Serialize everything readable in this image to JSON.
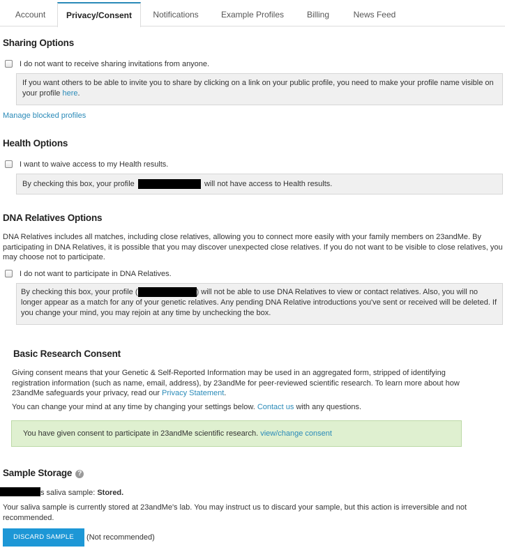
{
  "tabs": [
    "Account",
    "Privacy/Consent",
    "Notifications",
    "Example Profiles",
    "Billing",
    "News Feed"
  ],
  "sharing": {
    "title": "Sharing Options",
    "checkbox_label": "I do not want to receive sharing invitations from anyone.",
    "note_before": "If you want others to be able to invite you to share by clicking on a link on your public profile, you need to make your profile name visible on your profile ",
    "note_link": "here",
    "note_after": ".",
    "manage_link": "Manage blocked profiles"
  },
  "health": {
    "title": "Health Options",
    "checkbox_label": "I want to waive access to my Health results.",
    "note_before": "By checking this box, your profile",
    "note_after": "will not have access to Health results."
  },
  "dna": {
    "title": "DNA Relatives Options",
    "intro": "DNA Relatives includes all matches, including close relatives, allowing you to connect more easily with your family members on 23andMe. By participating in DNA Relatives, it is possible that you may discover unexpected close relatives. If you do not want to be visible to close relatives, you may choose not to participate.",
    "checkbox_label": "I do not want to participate in DNA Relatives.",
    "note_before": "By checking this box, your profile (",
    "note_after": ") will not be able to use DNA Relatives to view or contact relatives. Also, you will no longer appear as a match for any of your genetic relatives. Any pending DNA Relative introductions you've sent or received will be deleted. If you change your mind, you may rejoin at any time by unchecking the box."
  },
  "research": {
    "title": "Basic Research Consent",
    "para1_before": "Giving consent means that your Genetic & Self-Reported Information may be used in an aggregated form, stripped of identifying registration information (such as name, email, address), by 23andMe for peer-reviewed scientific research. To learn more about how 23andMe safeguards your privacy, read our ",
    "para1_link": "Privacy Statement",
    "para1_after": ".",
    "para2_before": "You can change your mind at any time by changing your settings below. ",
    "para2_link": "Contact us",
    "para2_after": " with any questions.",
    "consent_text": "You have given consent to participate in 23andMe scientific research. ",
    "consent_link": "view/change consent"
  },
  "storage": {
    "title": "Sample Storage",
    "help_glyph": "?",
    "status_suffix": "s saliva sample: ",
    "status_value": "Stored.",
    "description": "Your saliva sample is currently stored at 23andMe's lab. You may instruct us to discard your sample, but this action is irreversible and not recommended.",
    "discard_label": "DISCARD SAMPLE",
    "not_recommended": "(Not recommended)"
  }
}
